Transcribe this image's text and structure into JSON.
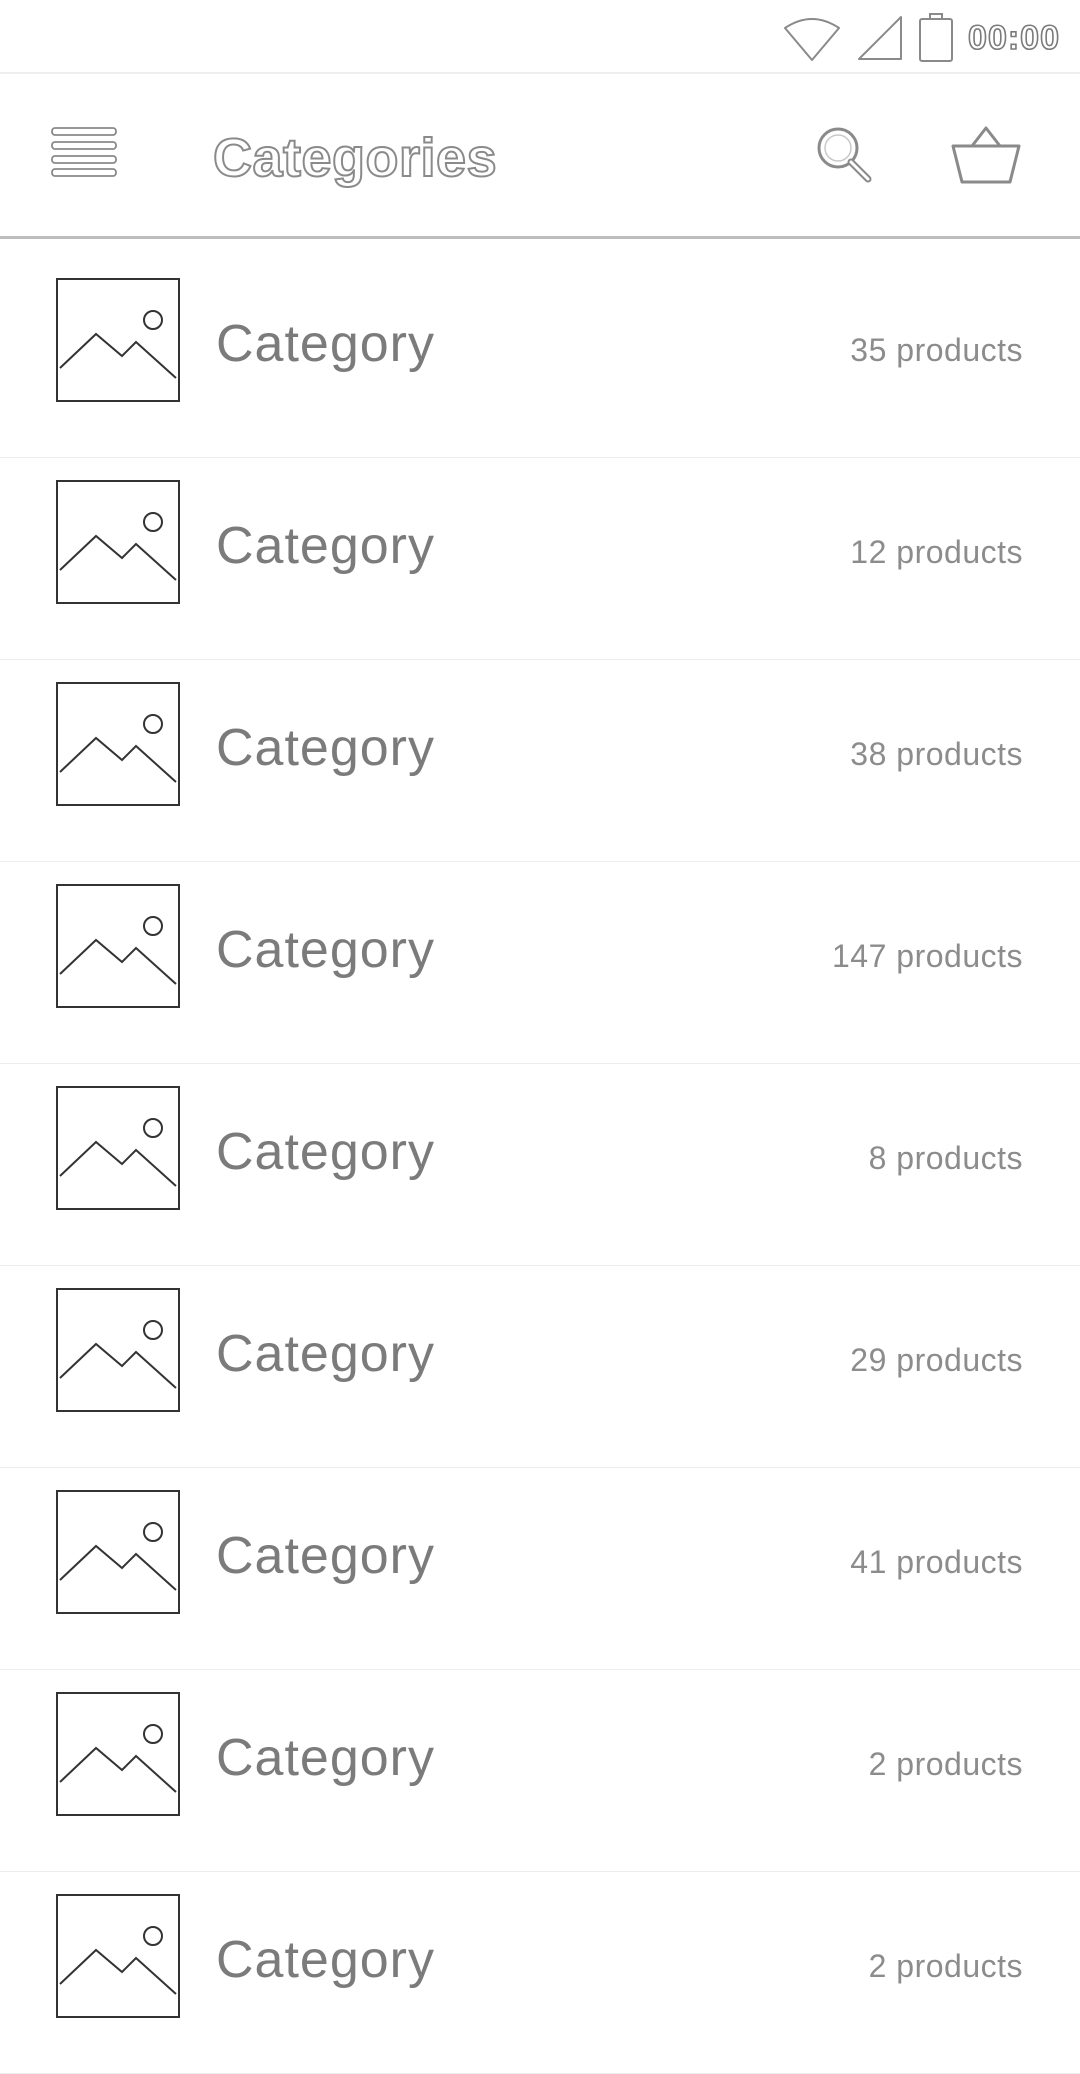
{
  "status_bar": {
    "time": "00:00",
    "icons": [
      "wifi-icon",
      "signal-icon",
      "battery-icon"
    ]
  },
  "app_bar": {
    "title": "Categories",
    "icons": [
      "menu-icon",
      "search-icon",
      "cart-basket-icon"
    ]
  },
  "categories": [
    {
      "name": "Category",
      "count": "35 products"
    },
    {
      "name": "Category",
      "count": "12 products"
    },
    {
      "name": "Category",
      "count": "38 products"
    },
    {
      "name": "Category",
      "count": "147 products"
    },
    {
      "name": "Category",
      "count": "8 products"
    },
    {
      "name": "Category",
      "count": "29 products"
    },
    {
      "name": "Category",
      "count": "41 products"
    },
    {
      "name": "Category",
      "count": "2 products"
    },
    {
      "name": "Category",
      "count": "2 products"
    }
  ],
  "colors": {
    "text": "#7b7b7b",
    "divider": "#ededed",
    "appbar_border": "#bdbdbd",
    "icon_stroke": "#8a8a8a"
  }
}
